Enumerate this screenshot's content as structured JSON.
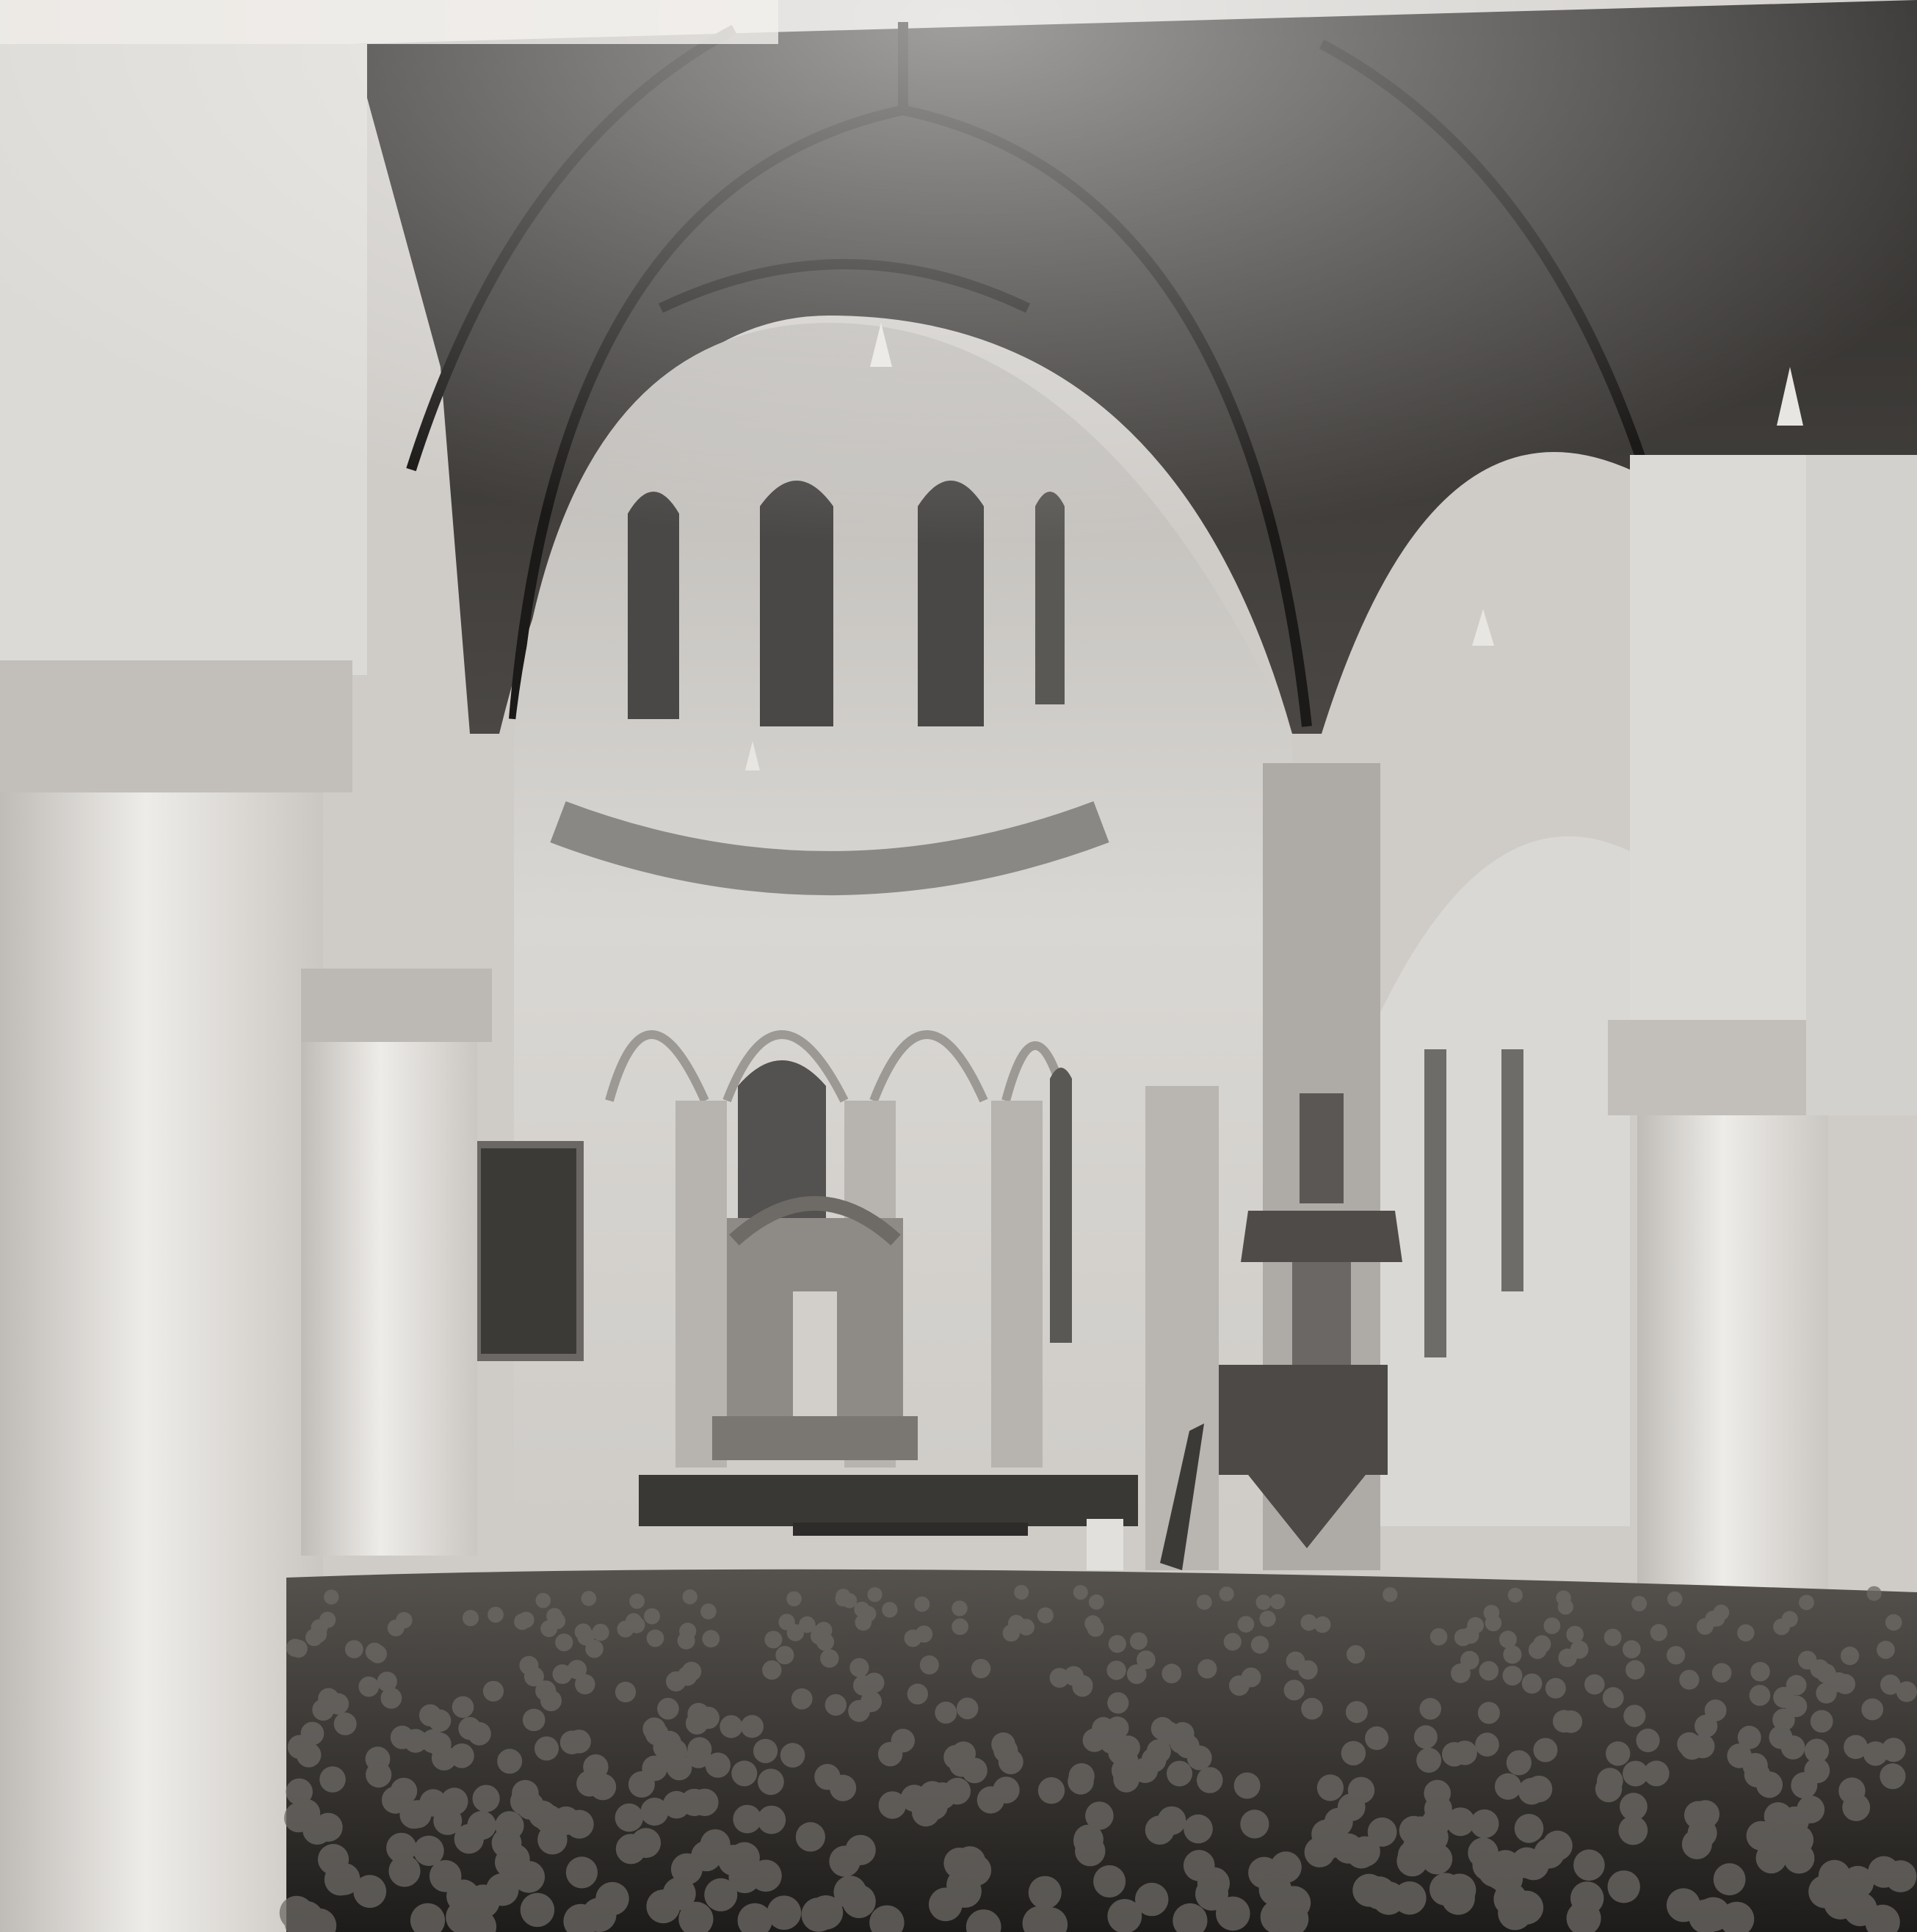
{
  "image": {
    "subject": "church-interior",
    "palette": {
      "ceiling": "#3a3835",
      "stone": "#d8d6d2",
      "column": "#e4e2de",
      "shadow": "#8a8884",
      "crowd": "#2e2c2a",
      "glass": "#4a4846"
    }
  }
}
